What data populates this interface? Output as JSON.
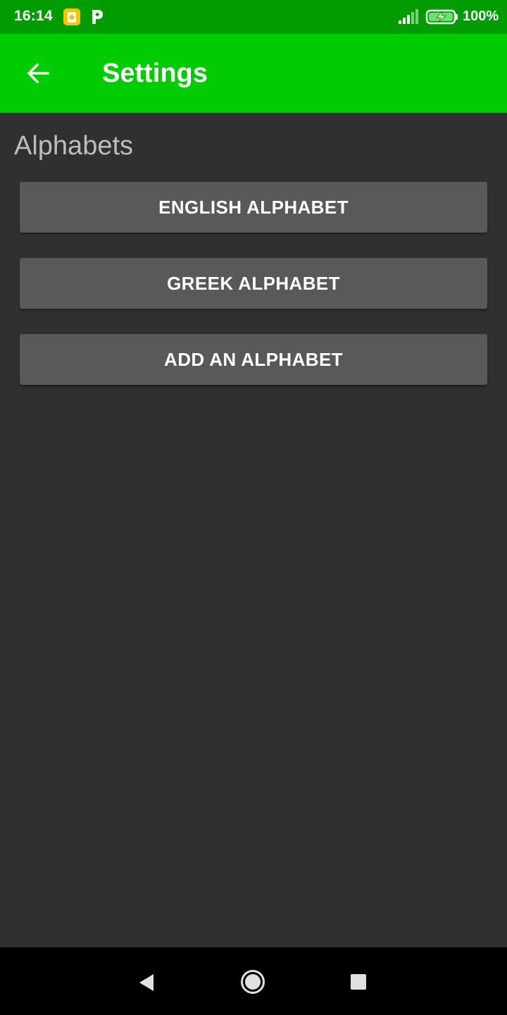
{
  "status_bar": {
    "time": "16:14",
    "battery_percent": "100%",
    "notification_icons": [
      "sim-toolkit-icon",
      "parking-app-icon"
    ],
    "signal_icon": "signal-icon",
    "battery_icon": "battery-charging-icon"
  },
  "app_bar": {
    "title": "Settings",
    "back_icon": "arrow-back-icon",
    "color": "#00cc00"
  },
  "section": {
    "heading": "Alphabets"
  },
  "buttons": [
    {
      "label": "ENGLISH ALPHABET"
    },
    {
      "label": "GREEK ALPHABET"
    },
    {
      "label": "ADD AN ALPHABET"
    }
  ],
  "nav_bar": {
    "back_icon": "triangle-back-icon",
    "home_icon": "circle-home-icon",
    "recents_icon": "square-recents-icon"
  },
  "colors": {
    "status_bar": "#019c01",
    "background": "#303030",
    "button": "#595959",
    "heading_text": "#bdbdbd"
  }
}
